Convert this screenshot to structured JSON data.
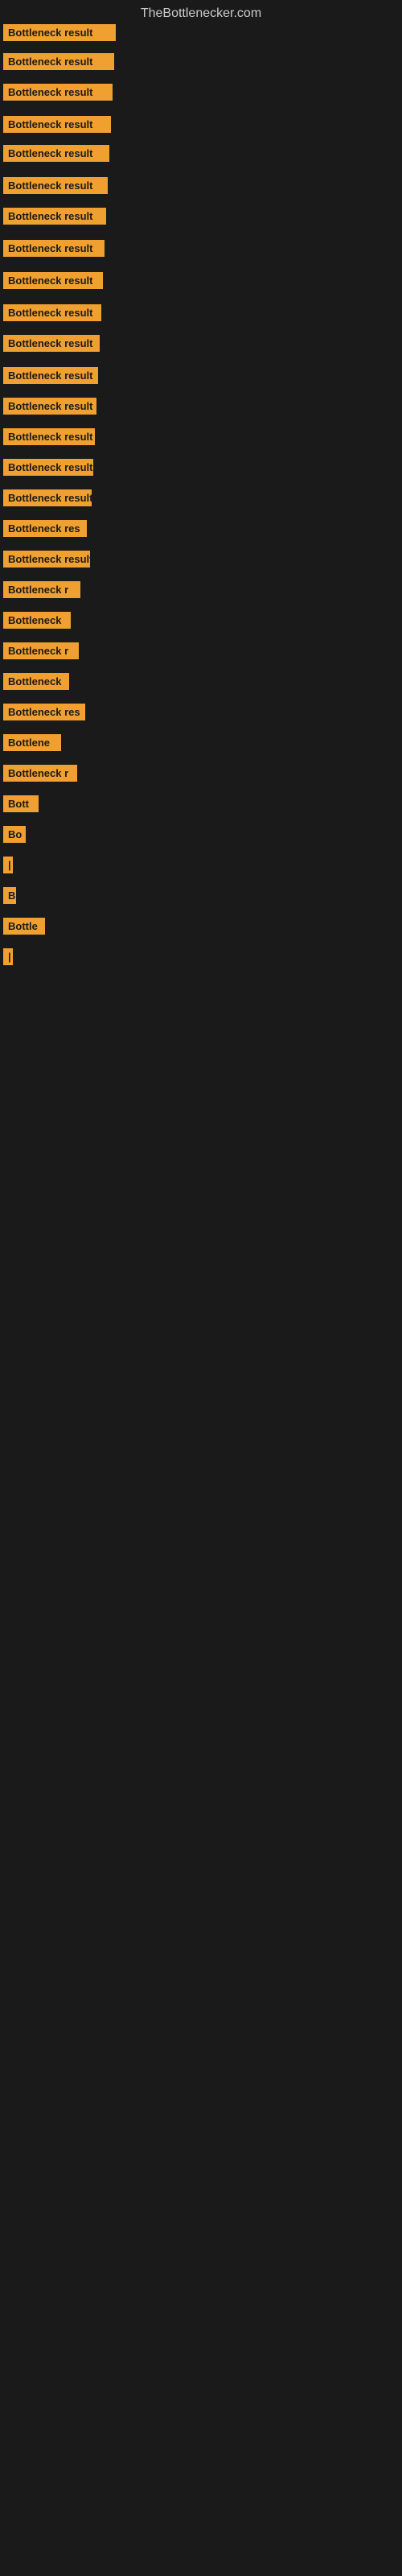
{
  "site": {
    "title": "TheBottlenecker.com"
  },
  "items": [
    {
      "label": "Bottleneck result",
      "width": 140,
      "spacing": 10
    },
    {
      "label": "Bottleneck result",
      "width": 138,
      "spacing": 12
    },
    {
      "label": "Bottleneck result",
      "width": 136,
      "spacing": 14
    },
    {
      "label": "Bottleneck result",
      "width": 134,
      "spacing": 10
    },
    {
      "label": "Bottleneck result",
      "width": 132,
      "spacing": 14
    },
    {
      "label": "Bottleneck result",
      "width": 130,
      "spacing": 12
    },
    {
      "label": "Bottleneck result",
      "width": 128,
      "spacing": 14
    },
    {
      "label": "Bottleneck result",
      "width": 126,
      "spacing": 14
    },
    {
      "label": "Bottleneck result",
      "width": 124,
      "spacing": 14
    },
    {
      "label": "Bottleneck result",
      "width": 122,
      "spacing": 12
    },
    {
      "label": "Bottleneck result",
      "width": 120,
      "spacing": 14
    },
    {
      "label": "Bottleneck result",
      "width": 118,
      "spacing": 12
    },
    {
      "label": "Bottleneck result",
      "width": 116,
      "spacing": 12
    },
    {
      "label": "Bottleneck result",
      "width": 114,
      "spacing": 12
    },
    {
      "label": "Bottleneck result",
      "width": 112,
      "spacing": 12
    },
    {
      "label": "Bottleneck result",
      "width": 110,
      "spacing": 12
    },
    {
      "label": "Bottleneck res",
      "width": 104,
      "spacing": 12
    },
    {
      "label": "Bottleneck result",
      "width": 108,
      "spacing": 12
    },
    {
      "label": "Bottleneck r",
      "width": 96,
      "spacing": 12
    },
    {
      "label": "Bottleneck",
      "width": 84,
      "spacing": 12
    },
    {
      "label": "Bottleneck r",
      "width": 94,
      "spacing": 12
    },
    {
      "label": "Bottleneck",
      "width": 82,
      "spacing": 12
    },
    {
      "label": "Bottleneck res",
      "width": 102,
      "spacing": 12
    },
    {
      "label": "Bottlene",
      "width": 72,
      "spacing": 12
    },
    {
      "label": "Bottleneck r",
      "width": 92,
      "spacing": 12
    },
    {
      "label": "Bott",
      "width": 44,
      "spacing": 12
    },
    {
      "label": "Bo",
      "width": 28,
      "spacing": 12
    },
    {
      "label": "|",
      "width": 8,
      "spacing": 12
    },
    {
      "label": "B",
      "width": 16,
      "spacing": 12
    },
    {
      "label": "Bottle",
      "width": 52,
      "spacing": 12
    },
    {
      "label": "|",
      "width": 6,
      "spacing": 60
    }
  ]
}
